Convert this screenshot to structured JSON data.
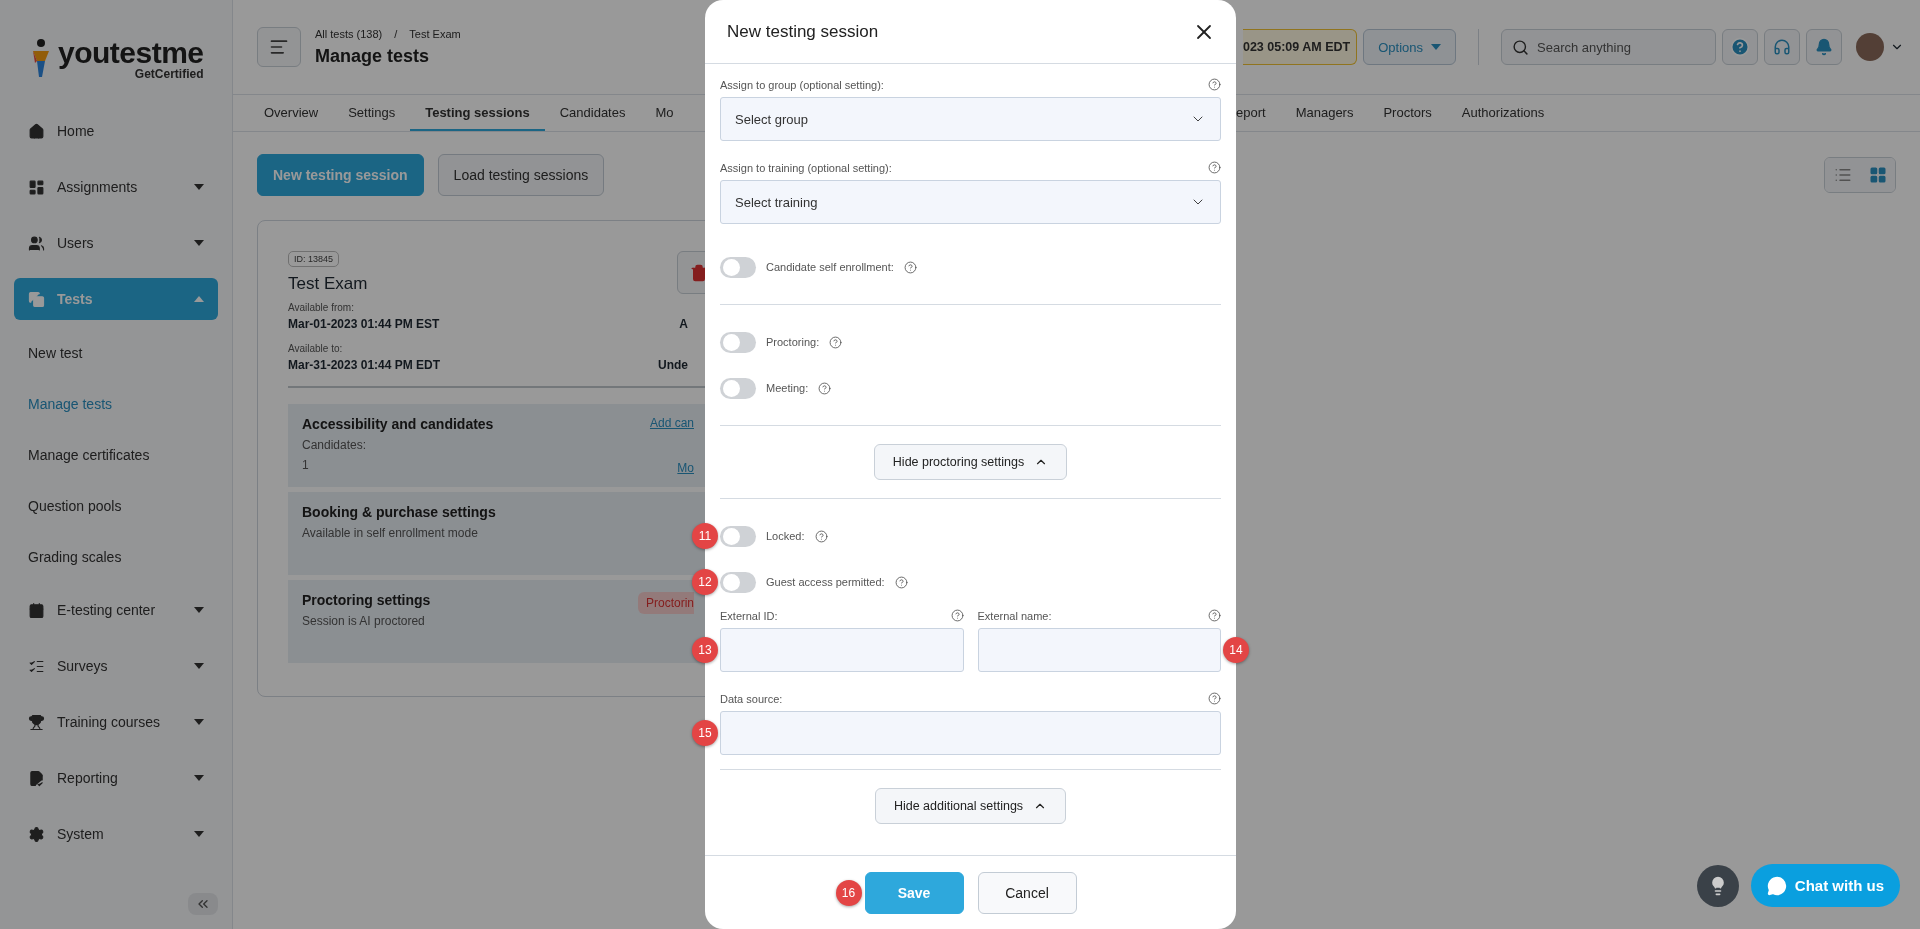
{
  "logo": {
    "name": "youtestme",
    "tagline": "GetCertified"
  },
  "sidebar": {
    "items": [
      {
        "label": "Home",
        "selected": false
      },
      {
        "label": "Assignments",
        "selected": false,
        "expanded": false
      },
      {
        "label": "Users",
        "selected": false,
        "expanded": false
      },
      {
        "label": "Tests",
        "selected": true,
        "expanded": true,
        "children": [
          {
            "label": "New test",
            "selected": false
          },
          {
            "label": "Manage tests",
            "selected": true
          },
          {
            "label": "Manage certificates",
            "selected": false
          },
          {
            "label": "Question pools",
            "selected": false
          },
          {
            "label": "Grading scales",
            "selected": false
          }
        ]
      },
      {
        "label": "E-testing center",
        "selected": false,
        "expanded": false
      },
      {
        "label": "Surveys",
        "selected": false,
        "expanded": false
      },
      {
        "label": "Training courses",
        "selected": false,
        "expanded": false
      },
      {
        "label": "Reporting",
        "selected": false,
        "expanded": false
      },
      {
        "label": "System",
        "selected": false,
        "expanded": false
      }
    ]
  },
  "header": {
    "breadcrumb": [
      "All tests (138)",
      "Test Exam"
    ],
    "separator": "/",
    "title": "Manage tests",
    "session_time": "023 05:09 AM EDT",
    "options": "Options",
    "search": {
      "placeholder": "Search anything"
    }
  },
  "tabs": {
    "left": [
      {
        "label": "Overview",
        "selected": false
      },
      {
        "label": "Settings",
        "selected": false
      },
      {
        "label": "Testing sessions",
        "selected": true
      },
      {
        "label": "Candidates",
        "selected": false
      },
      {
        "label": "Mo",
        "selected": false
      }
    ],
    "right": [
      {
        "label": "eport",
        "selected": false
      },
      {
        "label": "Managers",
        "selected": false
      },
      {
        "label": "Proctors",
        "selected": false
      },
      {
        "label": "Authorizations",
        "selected": false
      }
    ]
  },
  "actions": [
    "New testing session",
    "Load testing sessions"
  ],
  "view_modes": [
    {
      "selected": false
    },
    {
      "selected": true
    }
  ],
  "card": {
    "id": "ID: 13845",
    "title": "Test Exam",
    "fields": [
      {
        "label": "Available from:",
        "value": "Mar-01-2023 01:44 PM EST",
        "side": "A"
      },
      {
        "label": "Available to:",
        "value": "Mar-31-2023 01:44 PM EDT",
        "side": "Unde"
      }
    ],
    "sections": [
      {
        "title": "Accessibility and candidates",
        "link": "Add can",
        "lines": [
          "Candidates:",
          "1"
        ],
        "link2": "Mo"
      },
      {
        "title": "Booking & purchase settings",
        "lines": [
          "Available in self enrollment mode"
        ]
      },
      {
        "title": "Proctoring settings",
        "lines": [
          "Session is AI proctored"
        ],
        "badge": "Proctorin"
      }
    ]
  },
  "modal": {
    "title": "New testing session",
    "rows": [
      {
        "kind": "select",
        "label": "Assign to group (optional setting):",
        "placeholder": "Select group"
      },
      {
        "kind": "select",
        "label": "Assign to training (optional setting):",
        "placeholder": "Select training"
      },
      {
        "kind": "toggle",
        "label": "Candidate self enrollment:",
        "on": false
      },
      {
        "kind": "divider"
      },
      {
        "kind": "toggle",
        "label": "Proctoring:",
        "on": false
      },
      {
        "kind": "toggle",
        "label": "Meeting:",
        "on": false
      },
      {
        "kind": "divider"
      },
      {
        "kind": "collapse",
        "label": "Hide proctoring settings",
        "expanded": true
      },
      {
        "kind": "divider"
      },
      {
        "kind": "toggle",
        "label": "Locked:",
        "on": false,
        "callout": "11"
      },
      {
        "kind": "toggle",
        "label": "Guest access permitted:",
        "on": false,
        "callout": "12"
      },
      {
        "kind": "fields",
        "fields": [
          {
            "label": "External ID:",
            "callout": "13"
          },
          {
            "label": "External name:",
            "callout": "14"
          }
        ]
      },
      {
        "kind": "field",
        "label": "Data source:",
        "callout": "15"
      },
      {
        "kind": "divider"
      },
      {
        "kind": "collapse",
        "label": "Hide additional settings",
        "expanded": true
      }
    ],
    "buttons": [
      {
        "label": "Save",
        "kind": "primary",
        "callout": "16"
      },
      {
        "label": "Cancel",
        "kind": "secondary"
      }
    ]
  },
  "chat": {
    "label": "Chat with us"
  }
}
